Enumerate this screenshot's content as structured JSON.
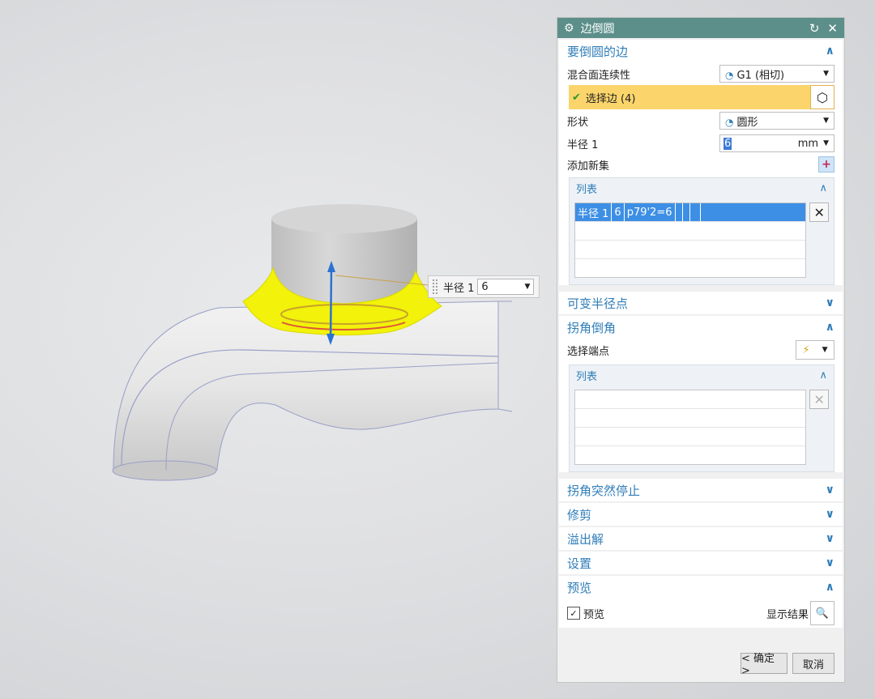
{
  "dialog": {
    "title": "边倒圆",
    "sections": {
      "edges": {
        "title": "要倒圆的边",
        "continuity_label": "混合面连续性",
        "continuity_value": "G1 (相切)",
        "select_label": "选择边 (4)",
        "shape_label": "形状",
        "shape_value": "圆形",
        "radius_label": "半径 1",
        "radius_value": "6",
        "radius_unit": "mm",
        "add_set_label": "添加新集",
        "list_title": "列表",
        "list_rows": [
          [
            "半径 1",
            "6",
            "p79'2=6",
            "",
            "",
            ""
          ]
        ]
      },
      "variable_radius": {
        "title": "可变半径点"
      },
      "corner_setback": {
        "title": "拐角倒角",
        "select_endpoint_label": "选择端点",
        "list_title": "列表"
      },
      "corner_stop": {
        "title": "拐角突然停止"
      },
      "trim": {
        "title": "修剪"
      },
      "overflow": {
        "title": "溢出解"
      },
      "settings": {
        "title": "设置"
      },
      "preview": {
        "title": "预览",
        "checkbox_label": "预览",
        "show_result_label": "显示结果"
      }
    },
    "buttons": {
      "ok": "< 确定 >",
      "cancel": "取消"
    }
  },
  "viewport": {
    "onscreen_label": "半径 1",
    "onscreen_value": "6"
  },
  "colors": {
    "title_bar": "#5c8f8a",
    "accent": "#2f7db8",
    "selection": "#fbd56b",
    "fillet": "#f2f20a"
  }
}
